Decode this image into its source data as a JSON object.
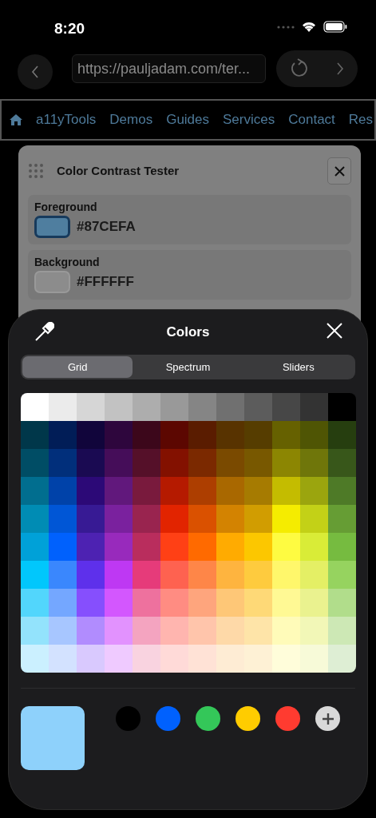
{
  "status_bar": {
    "time": "8:20"
  },
  "browser": {
    "url": "https://pauljadam.com/ter..."
  },
  "nav": {
    "items": [
      "a11yTools",
      "Demos",
      "Guides",
      "Services",
      "Contact",
      "Res"
    ]
  },
  "tester": {
    "title": "Color Contrast Tester",
    "fields": [
      {
        "label": "Foreground",
        "value": "#87CEFA",
        "color": "#4f7e9f",
        "selected": true
      },
      {
        "label": "Background",
        "value": "#FFFFFF",
        "color": "#8c8c8c",
        "selected": false
      }
    ]
  },
  "picker": {
    "title": "Colors",
    "tabs": [
      {
        "label": "Grid",
        "selected": true
      },
      {
        "label": "Spectrum",
        "selected": false
      },
      {
        "label": "Sliders",
        "selected": false
      }
    ],
    "grid": {
      "rows": [
        {
          "cells": [
            {
              "color": "#ffffff"
            },
            {
              "color": "#ebebeb"
            },
            {
              "color": "#d6d6d6"
            },
            {
              "color": "#c2c2c2"
            },
            {
              "color": "#adadad"
            },
            {
              "color": "#999999"
            },
            {
              "color": "#858585"
            },
            {
              "color": "#707070"
            },
            {
              "color": "#5c5c5c"
            },
            {
              "color": "#474747"
            },
            {
              "color": "#333333"
            },
            {
              "color": "#000000"
            }
          ]
        },
        {
          "cells": [
            {
              "color": "#00374a"
            },
            {
              "color": "#011d57"
            },
            {
              "color": "#11053b"
            },
            {
              "color": "#2e063d"
            },
            {
              "color": "#3c071b"
            },
            {
              "color": "#5c0701"
            },
            {
              "color": "#5a1c00"
            },
            {
              "color": "#583300"
            },
            {
              "color": "#563d00"
            },
            {
              "color": "#666100"
            },
            {
              "color": "#4f5504"
            },
            {
              "color": "#263e0f"
            }
          ]
        },
        {
          "cells": [
            {
              "color": "#004d65"
            },
            {
              "color": "#012f7b"
            },
            {
              "color": "#1a0a52"
            },
            {
              "color": "#450d59"
            },
            {
              "color": "#551029"
            },
            {
              "color": "#831100"
            },
            {
              "color": "#7b2900"
            },
            {
              "color": "#7a4a00"
            },
            {
              "color": "#785800"
            },
            {
              "color": "#8c8602"
            },
            {
              "color": "#6f760a"
            },
            {
              "color": "#38571a"
            }
          ]
        },
        {
          "cells": [
            {
              "color": "#016e8f"
            },
            {
              "color": "#0042a9"
            },
            {
              "color": "#2c0977"
            },
            {
              "color": "#61187c"
            },
            {
              "color": "#791a3d"
            },
            {
              "color": "#b51a00"
            },
            {
              "color": "#ad3e00"
            },
            {
              "color": "#a96800"
            },
            {
              "color": "#a67b01"
            },
            {
              "color": "#c4bc00"
            },
            {
              "color": "#9ba50e"
            },
            {
              "color": "#4e7a27"
            }
          ]
        },
        {
          "cells": [
            {
              "color": "#008cb4"
            },
            {
              "color": "#0056d6"
            },
            {
              "color": "#371a94"
            },
            {
              "color": "#7a219e"
            },
            {
              "color": "#99244f"
            },
            {
              "color": "#e22400"
            },
            {
              "color": "#da5100"
            },
            {
              "color": "#d38301"
            },
            {
              "color": "#d19d01"
            },
            {
              "color": "#f5ec00"
            },
            {
              "color": "#c3d117"
            },
            {
              "color": "#669d34"
            }
          ]
        },
        {
          "cells": [
            {
              "color": "#00a1d8"
            },
            {
              "color": "#0061fd"
            },
            {
              "color": "#4d22b2"
            },
            {
              "color": "#982abc"
            },
            {
              "color": "#b92d5d"
            },
            {
              "color": "#ff4015"
            },
            {
              "color": "#ff6a00"
            },
            {
              "color": "#ffab01"
            },
            {
              "color": "#fcc700"
            },
            {
              "color": "#fefb41"
            },
            {
              "color": "#d9ec37"
            },
            {
              "color": "#76bb40"
            }
          ]
        },
        {
          "cells": [
            {
              "color": "#01c7fc"
            },
            {
              "color": "#3a87fd"
            },
            {
              "color": "#5e30eb"
            },
            {
              "color": "#be38f3"
            },
            {
              "color": "#e63b7a"
            },
            {
              "color": "#fe6250"
            },
            {
              "color": "#fe8648"
            },
            {
              "color": "#feb43f"
            },
            {
              "color": "#fecb3e"
            },
            {
              "color": "#fff76b"
            },
            {
              "color": "#e4ef65"
            },
            {
              "color": "#96d35f"
            }
          ]
        },
        {
          "cells": [
            {
              "color": "#52d6fc"
            },
            {
              "color": "#74a7ff"
            },
            {
              "color": "#864ffd"
            },
            {
              "color": "#d357fe"
            },
            {
              "color": "#ee719e"
            },
            {
              "color": "#ff8c82"
            },
            {
              "color": "#fea57d"
            },
            {
              "color": "#fec777"
            },
            {
              "color": "#fed977"
            },
            {
              "color": "#fff994"
            },
            {
              "color": "#eaf28f"
            },
            {
              "color": "#b1dd8b"
            }
          ]
        },
        {
          "cells": [
            {
              "color": "#93e3fc"
            },
            {
              "color": "#a7c6ff"
            },
            {
              "color": "#b18cfe"
            },
            {
              "color": "#e292fe"
            },
            {
              "color": "#f4a4c0"
            },
            {
              "color": "#ffb5af"
            },
            {
              "color": "#ffc5ab"
            },
            {
              "color": "#fed9a8"
            },
            {
              "color": "#fee4a8"
            },
            {
              "color": "#fffbb9"
            },
            {
              "color": "#f2f7b7"
            },
            {
              "color": "#cde8b5"
            }
          ]
        },
        {
          "cells": [
            {
              "color": "#cbf0ff"
            },
            {
              "color": "#d3e2ff"
            },
            {
              "color": "#d9c9fe"
            },
            {
              "color": "#efcaff"
            },
            {
              "color": "#f9d3e0"
            },
            {
              "color": "#ffdad8"
            },
            {
              "color": "#ffe2d6"
            },
            {
              "color": "#feecd4"
            },
            {
              "color": "#fef1d5"
            },
            {
              "color": "#fffdda"
            },
            {
              "color": "#f7fad8"
            },
            {
              "color": "#deeed4"
            }
          ]
        }
      ]
    },
    "current": {
      "color": "#8ed1fb"
    },
    "recent": [
      {
        "color": "#000000"
      },
      {
        "color": "#0061fe"
      },
      {
        "color": "#34c759"
      },
      {
        "color": "#ffcc00"
      },
      {
        "color": "#ff3b30"
      }
    ]
  }
}
